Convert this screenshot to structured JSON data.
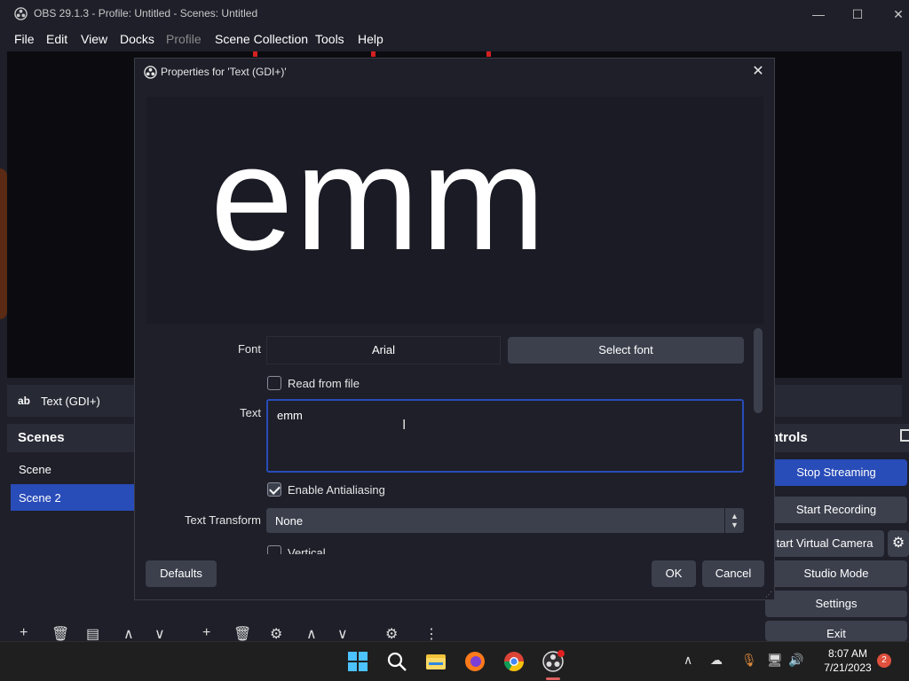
{
  "window": {
    "title": "OBS 29.1.3 - Profile: Untitled - Scenes: Untitled",
    "minimize": "—",
    "maximize": "☐",
    "close": "✕"
  },
  "menu": {
    "items": [
      "File",
      "Edit",
      "View",
      "Docks",
      "Profile",
      "Scene Collection",
      "Tools",
      "Help"
    ],
    "disabled": [
      "Profile"
    ]
  },
  "source_strip": {
    "icon_text": "ab",
    "name": "Text (GDI+)"
  },
  "scenes": {
    "title": "Scenes",
    "items": [
      "Scene",
      "Scene 2"
    ],
    "active_index": 1
  },
  "controls": {
    "title": "ntrols",
    "buttons": [
      "Stop Streaming",
      "Start Recording",
      "tart Virtual Camera",
      "Studio Mode",
      "Settings",
      "Exit"
    ],
    "active_index": 0
  },
  "dialog": {
    "title": "Properties for 'Text (GDI+)'",
    "close": "✕",
    "preview_text": "emm",
    "font_label": "Font",
    "font_value": "Arial",
    "select_font_label": "Select font",
    "read_from_file_label": "Read from file",
    "read_from_file_checked": false,
    "text_label": "Text",
    "text_value": "emm",
    "antialiasing_label": "Enable Antialiasing",
    "antialiasing_checked": true,
    "transform_label": "Text Transform",
    "transform_value": "None",
    "vertical_label": "Vertical",
    "defaults_label": "Defaults",
    "ok_label": "OK",
    "cancel_label": "Cancel"
  },
  "taskbar": {
    "time": "8:07 AM",
    "date": "7/21/2023",
    "notification_count": "2",
    "apps": [
      "windows-start-icon",
      "search-icon",
      "file-explorer-icon",
      "firefox-icon",
      "chrome-icon",
      "obs-icon"
    ]
  },
  "colors": {
    "accent": "#284cb8",
    "background": "#1e1f29",
    "button": "#3c404d"
  }
}
